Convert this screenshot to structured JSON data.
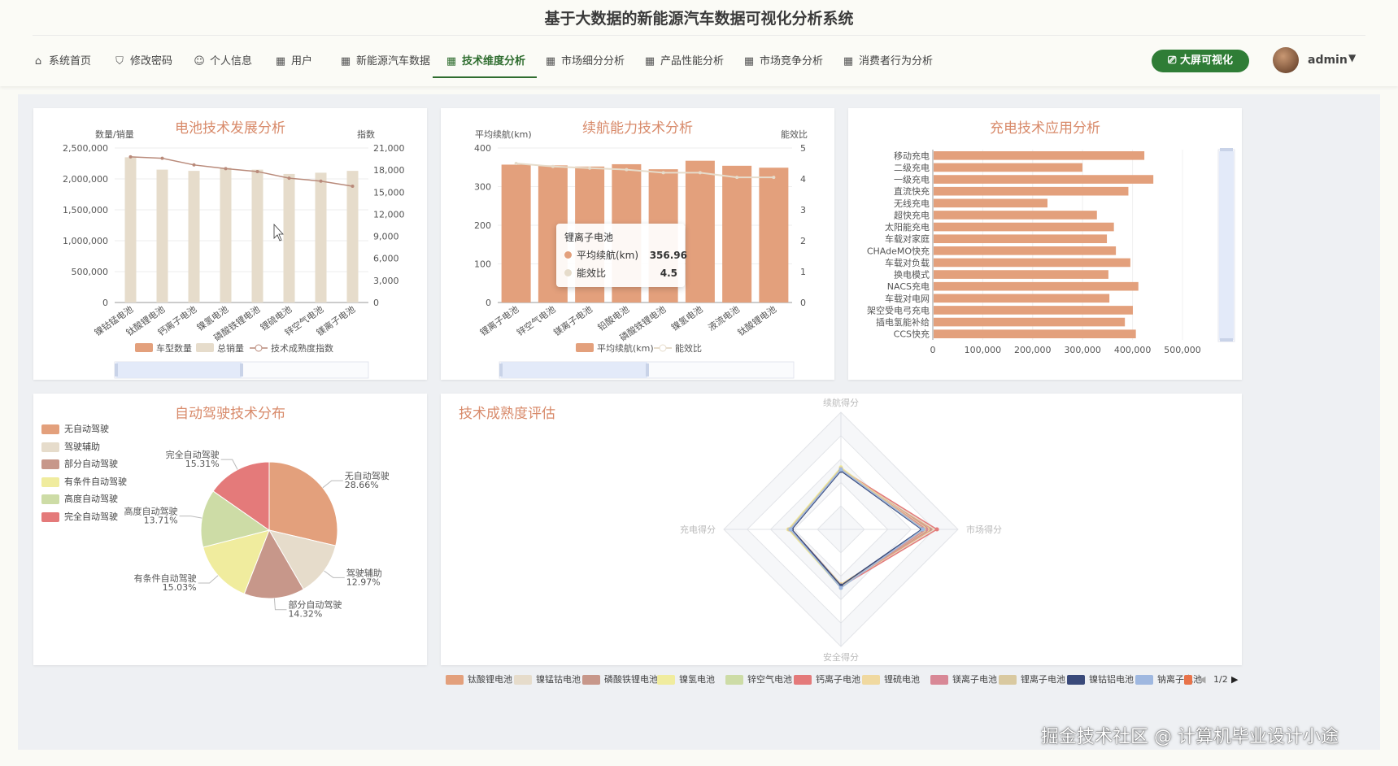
{
  "app": {
    "title": "基于大数据的新能源汽车数据可视化分析系统"
  },
  "nav": {
    "items": [
      {
        "label": "系统首页",
        "icon": "home-icon"
      },
      {
        "label": "修改密码",
        "icon": "lock-icon"
      },
      {
        "label": "个人信息",
        "icon": "user-icon"
      },
      {
        "label": "用户",
        "icon": "grid-icon"
      },
      {
        "label": "新能源汽车数据",
        "icon": "grid-icon"
      },
      {
        "label": "技术维度分析",
        "icon": "grid-icon",
        "active": true
      },
      {
        "label": "市场细分分析",
        "icon": "grid-icon"
      },
      {
        "label": "产品性能分析",
        "icon": "grid-icon"
      },
      {
        "label": "市场竞争分析",
        "icon": "grid-icon"
      },
      {
        "label": "消费者行为分析",
        "icon": "grid-icon"
      }
    ],
    "big_screen_label": "大屏可视化",
    "user": "admin"
  },
  "colors": {
    "accent": "#2f7d36",
    "bar": "#e3a07c",
    "bar_light": "#e6dccb",
    "title": "#d88a6a"
  },
  "panels": {
    "battery": {
      "title": "电池技术发展分析",
      "ylabel_left": "数量/销量",
      "ylabel_right": "指数",
      "legend": [
        "车型数量",
        "总销量",
        "技术成熟度指数"
      ]
    },
    "range": {
      "title": "续航能力技术分析",
      "ylabel_left": "平均续航(km)",
      "ylabel_right": "能效比",
      "legend": [
        "平均续航(km)",
        "能效比"
      ],
      "tooltip": {
        "title": "锂离子电池",
        "rows": [
          {
            "label": "平均续航(km)",
            "value": "356.96"
          },
          {
            "label": "能效比",
            "value": "4.5"
          }
        ]
      }
    },
    "charging": {
      "title": "充电技术应用分析"
    },
    "autonomy": {
      "title": "自动驾驶技术分布"
    },
    "maturity": {
      "title": "技术成熟度评估",
      "page": "1/2"
    }
  },
  "chart_data": [
    {
      "type": "bar",
      "title": "电池技术发展分析",
      "categories": [
        "镍钴锰电池",
        "钛酸锂电池",
        "钙离子电池",
        "镍氢电池",
        "磷酸铁锂电池",
        "锂硫电池",
        "锌空气电池",
        "镁离子电池"
      ],
      "series": [
        {
          "name": "车型数量",
          "axis": "left",
          "values": [
            0,
            0,
            0,
            0,
            0,
            0,
            0,
            0
          ]
        },
        {
          "name": "总销量",
          "axis": "left",
          "values": [
            2350000,
            2150000,
            2130000,
            2180000,
            2150000,
            2080000,
            2100000,
            2130000
          ]
        },
        {
          "name": "技术成熟度指数",
          "axis": "right",
          "type": "line",
          "values": [
            19800,
            19600,
            18700,
            18200,
            17800,
            16900,
            16500,
            15800
          ]
        }
      ],
      "ylabel": "数量/销量",
      "ylabel_right": "指数",
      "yticks": [
        "0",
        "500,000",
        "1,000,000",
        "1,500,000",
        "2,000,000",
        "2,500,000"
      ],
      "yticks_right": [
        "0",
        "3,000",
        "6,000",
        "9,000",
        "12,000",
        "15,000",
        "18,000",
        "21,000"
      ],
      "ylim": [
        0,
        2500000
      ],
      "ylim_right": [
        0,
        21000
      ],
      "legend_position": "bottom"
    },
    {
      "type": "bar",
      "title": "续航能力技术分析",
      "categories": [
        "锂离子电池",
        "锌空气电池",
        "镁离子电池",
        "铅酸电池",
        "磷酸铁锂电池",
        "镍氢电池",
        "液流电池",
        "钛酸锂电池"
      ],
      "series": [
        {
          "name": "平均续航(km)",
          "axis": "left",
          "values": [
            356.96,
            355,
            352,
            358,
            345,
            367,
            354,
            349
          ]
        },
        {
          "name": "能效比",
          "axis": "right",
          "type": "line",
          "values": [
            4.5,
            4.4,
            4.35,
            4.3,
            4.2,
            4.2,
            4.05,
            4.05
          ]
        }
      ],
      "ylabel": "平均续航(km)",
      "ylabel_right": "能效比",
      "yticks": [
        "0",
        "100",
        "200",
        "300",
        "400"
      ],
      "yticks_right": [
        "0",
        "1",
        "2",
        "3",
        "4",
        "5"
      ],
      "ylim": [
        0,
        400
      ],
      "ylim_right": [
        0,
        5
      ],
      "legend_position": "bottom"
    },
    {
      "type": "bar",
      "orientation": "horizontal",
      "title": "充电技术应用分析",
      "categories": [
        "移动充电",
        "二级充电",
        "一级充电",
        "直流快充",
        "无线充电",
        "超快充电",
        "太阳能充电",
        "车载对家庭",
        "CHAdeMO快充",
        "车载对负载",
        "换电模式",
        "NACS充电",
        "车载对电网",
        "架空受电弓充电",
        "插电氢能补给",
        "CCS快充"
      ],
      "values": [
        422000,
        298000,
        440000,
        390000,
        228000,
        327000,
        361000,
        347000,
        365000,
        394000,
        350000,
        410000,
        352000,
        399000,
        383000,
        405000
      ],
      "xticks": [
        "0",
        "100,000",
        "200,000",
        "300,000",
        "400,000",
        "500,000"
      ],
      "xlim": [
        0,
        500000
      ]
    },
    {
      "type": "pie",
      "title": "自动驾驶技术分布",
      "labels": [
        "无自动驾驶",
        "驾驶辅助",
        "部分自动驾驶",
        "有条件自动驾驶",
        "高度自动驾驶",
        "完全自动驾驶"
      ],
      "values": [
        28.66,
        12.97,
        14.32,
        15.03,
        13.71,
        15.31
      ],
      "value_labels": [
        "28.66%",
        "12.97%",
        "14.32%",
        "15.03%",
        "13.71%",
        "15.31%"
      ],
      "colors": [
        "#e3a07c",
        "#e6dccb",
        "#c7978a",
        "#f0ec9e",
        "#cddca6",
        "#e47a7a"
      ],
      "legend_position": "top-left"
    },
    {
      "type": "radar",
      "title": "技术成熟度评估",
      "indicators": [
        "续航得分",
        "市场得分",
        "安全得分",
        "充电得分"
      ],
      "series_names": [
        "钛酸锂电池",
        "镍锰钴电池",
        "磷酸铁锂电池",
        "镍氢电池",
        "锌空气电池",
        "钙离子电池",
        "锂硫电池",
        "镁离子电池",
        "锂离子电池",
        "镍钴铝电池",
        "钠离子电池"
      ],
      "colors": [
        "#e3a07c",
        "#e6dccb",
        "#c7978a",
        "#f0ec9e",
        "#cddca6",
        "#e47a7a",
        "#f0d9a0",
        "#d88896",
        "#d9c9a0",
        "#3a4a7a",
        "#9fb8e0"
      ],
      "values": [
        [
          0.52,
          0.78,
          0.48,
          0.42
        ],
        [
          0.5,
          0.8,
          0.49,
          0.43
        ],
        [
          0.51,
          0.76,
          0.47,
          0.42
        ],
        [
          0.53,
          0.7,
          0.5,
          0.45
        ],
        [
          0.5,
          0.72,
          0.48,
          0.44
        ],
        [
          0.51,
          0.82,
          0.49,
          0.43
        ],
        [
          0.52,
          0.74,
          0.47,
          0.43
        ],
        [
          0.51,
          0.73,
          0.48,
          0.44
        ],
        [
          0.52,
          0.71,
          0.49,
          0.44
        ],
        [
          0.5,
          0.69,
          0.48,
          0.42
        ],
        [
          0.51,
          0.7,
          0.5,
          0.43
        ]
      ],
      "legend_position": "bottom"
    }
  ],
  "watermark": "掘金技术社区 @ 计算机毕业设计小途"
}
